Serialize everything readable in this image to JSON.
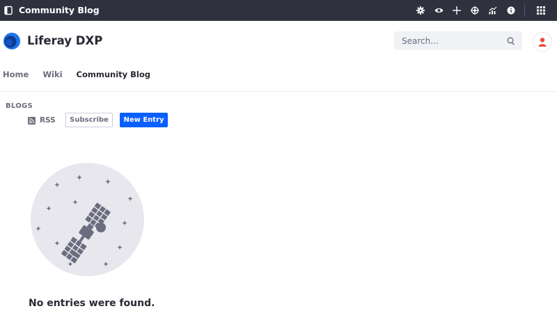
{
  "control_menu": {
    "title": "Community Blog",
    "icons": [
      "sidebar-toggle-icon",
      "gear-icon",
      "eye-icon",
      "plus-icon",
      "simulation-icon",
      "analytics-icon",
      "info-icon",
      "apps-grid-icon"
    ],
    "background": "#30313f"
  },
  "header": {
    "site_name": "Liferay DXP",
    "search": {
      "placeholder": "Search..."
    },
    "avatar_icon": "user-icon",
    "accent": "#e8473b"
  },
  "nav": {
    "items": [
      {
        "label": "Home"
      },
      {
        "label": "Wiki"
      },
      {
        "label": "Community Blog"
      }
    ],
    "active": "Community Blog"
  },
  "blogs": {
    "portlet_title": "BLOGS",
    "rss_label": "RSS",
    "subscribe_label": "Subscribe",
    "new_entry_label": "New Entry",
    "primary_color": "#0b5fff",
    "empty_message": "No entries were found.",
    "empty_icon": "satellite-icon"
  }
}
